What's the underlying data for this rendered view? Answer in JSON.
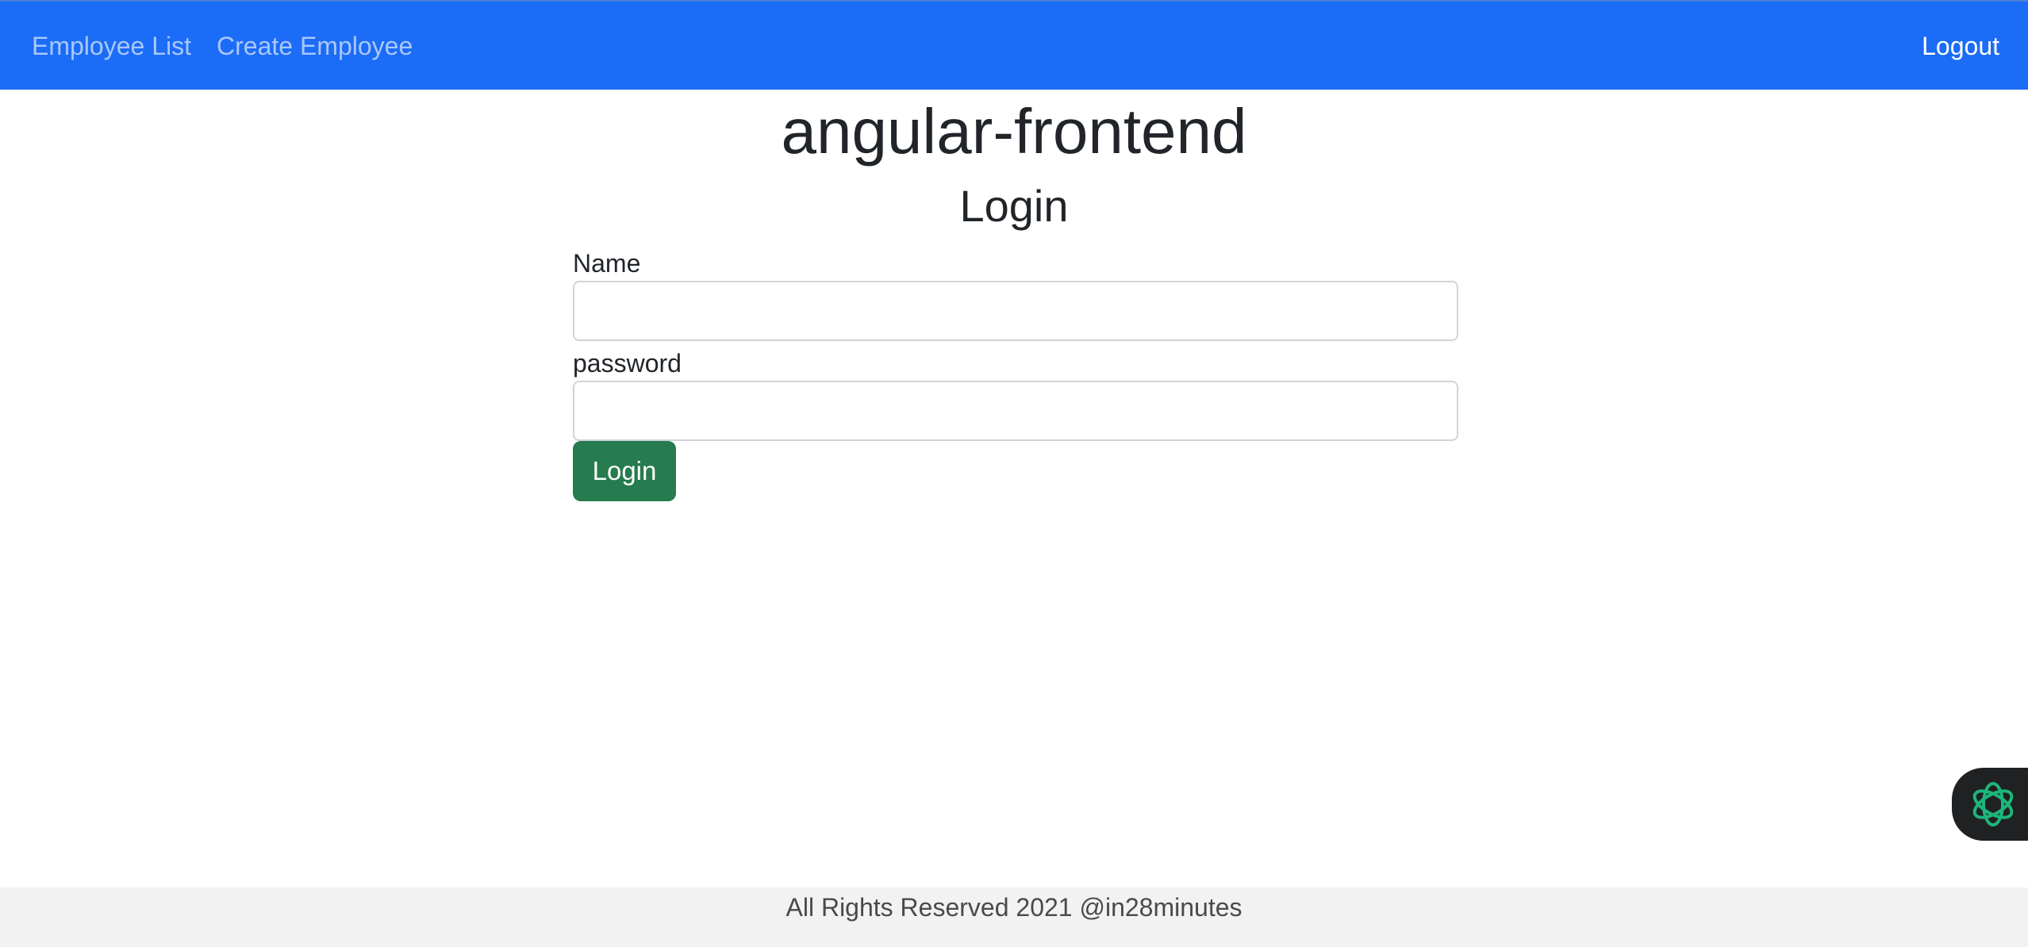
{
  "navbar": {
    "links": {
      "employee_list": "Employee List",
      "create_employee": "Create Employee"
    },
    "logout_label": "Logout",
    "background_color": "#1b6cf7"
  },
  "main": {
    "app_title": "angular-frontend",
    "form_heading": "Login",
    "name_label": "Name",
    "name_value": "",
    "password_label": "password",
    "password_value": "",
    "login_button_label": "Login",
    "login_button_color": "#267c4e"
  },
  "assistant_widget": {
    "icon": "openai-knot-icon",
    "icon_color": "#1db57a"
  },
  "footer": {
    "text": "All Rights Reserved 2021 @in28minutes"
  }
}
